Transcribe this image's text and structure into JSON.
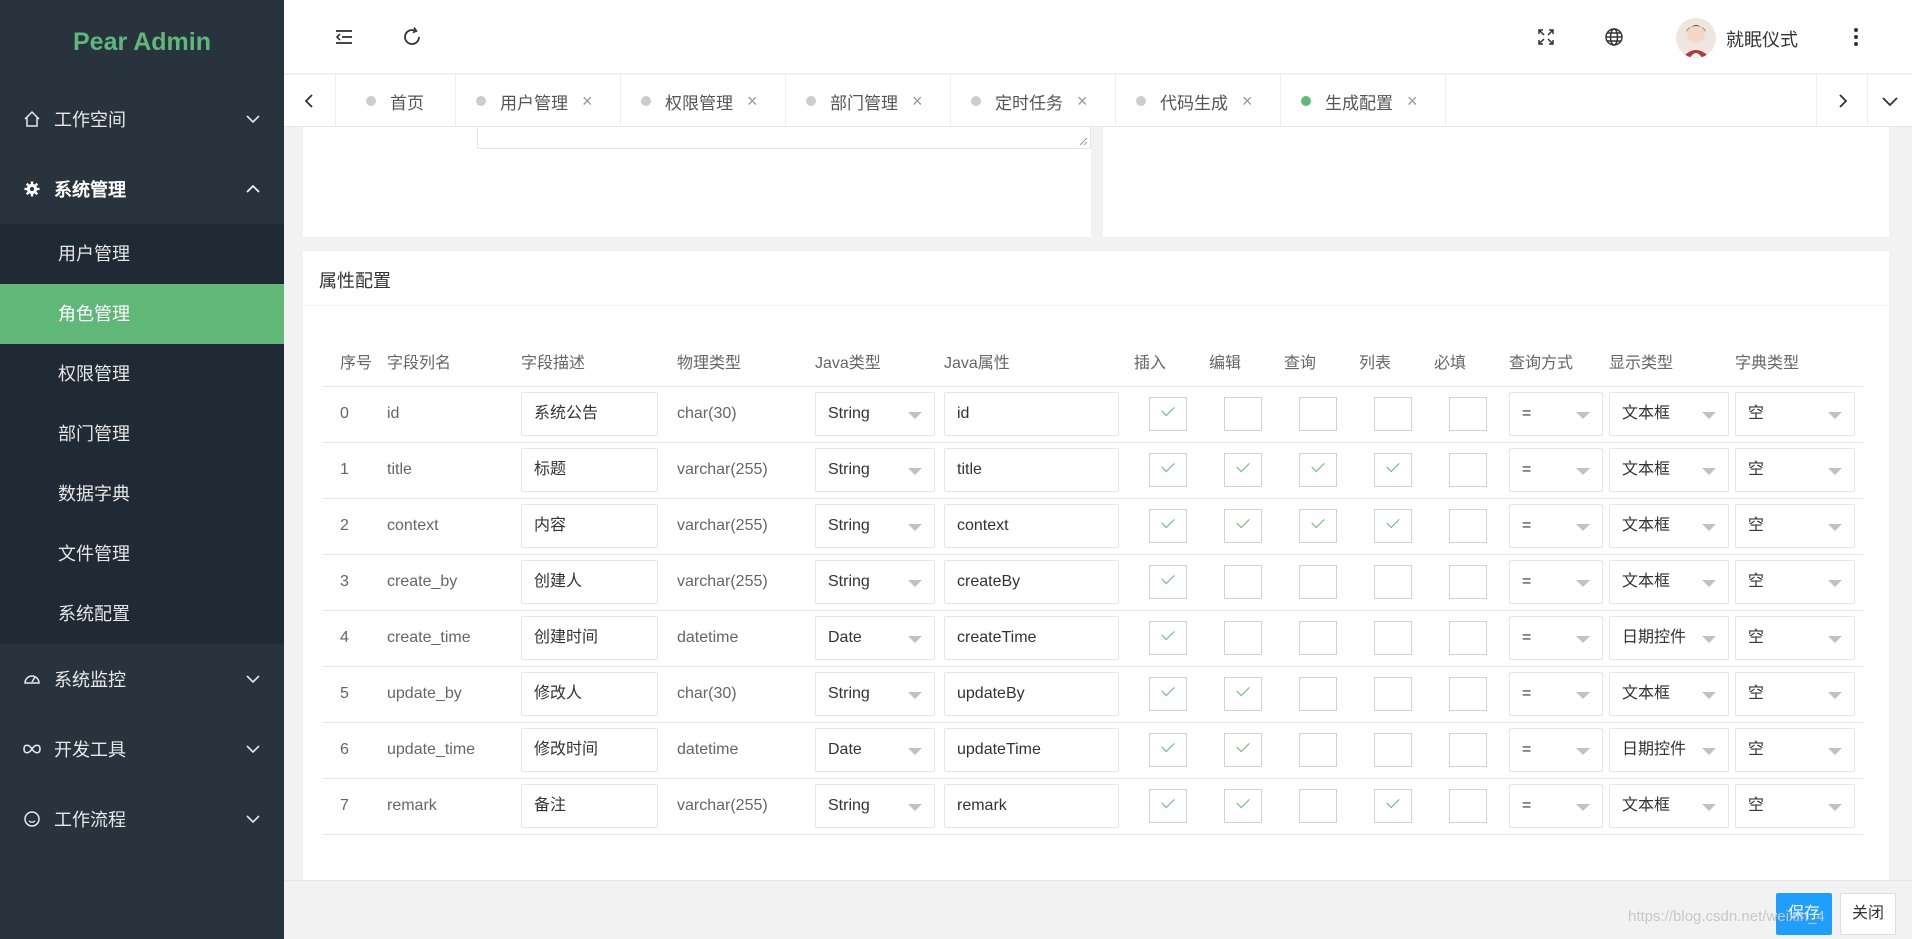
{
  "app": {
    "title": "Pear Admin"
  },
  "sidebar": {
    "groups": [
      {
        "label": "工作空间",
        "icon": "home-icon",
        "expanded": false
      },
      {
        "label": "系统管理",
        "icon": "gear-icon",
        "expanded": true
      },
      {
        "label": "系统监控",
        "icon": "dashboard-icon",
        "expanded": false
      },
      {
        "label": "开发工具",
        "icon": "infinity-icon",
        "expanded": false
      },
      {
        "label": "工作流程",
        "icon": "smile-icon",
        "expanded": false
      }
    ],
    "sub_items": [
      {
        "label": "用户管理",
        "active": false
      },
      {
        "label": "角色管理",
        "active": true
      },
      {
        "label": "权限管理",
        "active": false
      },
      {
        "label": "部门管理",
        "active": false
      },
      {
        "label": "数据字典",
        "active": false
      },
      {
        "label": "文件管理",
        "active": false
      },
      {
        "label": "系统配置",
        "active": false
      }
    ]
  },
  "header": {
    "username": "就眠仪式",
    "icons": [
      "menu-fold-icon",
      "refresh-icon",
      "fullscreen-icon",
      "globe-icon",
      "more-vertical-icon"
    ]
  },
  "tabs": [
    {
      "label": "首页",
      "closable": false,
      "active": false
    },
    {
      "label": "用户管理",
      "closable": true,
      "active": false
    },
    {
      "label": "权限管理",
      "closable": true,
      "active": false
    },
    {
      "label": "部门管理",
      "closable": true,
      "active": false
    },
    {
      "label": "定时任务",
      "closable": true,
      "active": false
    },
    {
      "label": "代码生成",
      "closable": true,
      "active": false
    },
    {
      "label": "生成配置",
      "closable": true,
      "active": true
    }
  ],
  "attr_config": {
    "title": "属性配置",
    "headers": {
      "idx": "序号",
      "name": "字段列名",
      "desc": "字段描述",
      "phys": "物理类型",
      "jtype": "Java类型",
      "jattr": "Java属性",
      "insert": "插入",
      "edit": "编辑",
      "query": "查询",
      "list": "列表",
      "required": "必填",
      "query_method": "查询方式",
      "display": "显示类型",
      "dict": "字典类型"
    },
    "rows": [
      {
        "idx": "0",
        "name": "id",
        "desc": "系统公告",
        "phys": "char(30)",
        "jtype": "String",
        "jattr": "id",
        "insert": true,
        "edit": false,
        "query": false,
        "list": false,
        "required": false,
        "query_method": "=",
        "display": "文本框",
        "dict": "空"
      },
      {
        "idx": "1",
        "name": "title",
        "desc": "标题",
        "phys": "varchar(255)",
        "jtype": "String",
        "jattr": "title",
        "insert": true,
        "edit": true,
        "query": true,
        "list": true,
        "required": false,
        "query_method": "=",
        "display": "文本框",
        "dict": "空"
      },
      {
        "idx": "2",
        "name": "context",
        "desc": "内容",
        "phys": "varchar(255)",
        "jtype": "String",
        "jattr": "context",
        "insert": true,
        "edit": true,
        "query": true,
        "list": true,
        "required": false,
        "query_method": "=",
        "display": "文本框",
        "dict": "空"
      },
      {
        "idx": "3",
        "name": "create_by",
        "desc": "创建人",
        "phys": "varchar(255)",
        "jtype": "String",
        "jattr": "createBy",
        "insert": true,
        "edit": false,
        "query": false,
        "list": false,
        "required": false,
        "query_method": "=",
        "display": "文本框",
        "dict": "空"
      },
      {
        "idx": "4",
        "name": "create_time",
        "desc": "创建时间",
        "phys": "datetime",
        "jtype": "Date",
        "jattr": "createTime",
        "insert": true,
        "edit": false,
        "query": false,
        "list": false,
        "required": false,
        "query_method": "=",
        "display": "日期控件",
        "dict": "空"
      },
      {
        "idx": "5",
        "name": "update_by",
        "desc": "修改人",
        "phys": "char(30)",
        "jtype": "String",
        "jattr": "updateBy",
        "insert": true,
        "edit": true,
        "query": false,
        "list": false,
        "required": false,
        "query_method": "=",
        "display": "文本框",
        "dict": "空"
      },
      {
        "idx": "6",
        "name": "update_time",
        "desc": "修改时间",
        "phys": "datetime",
        "jtype": "Date",
        "jattr": "updateTime",
        "insert": true,
        "edit": true,
        "query": false,
        "list": false,
        "required": false,
        "query_method": "=",
        "display": "日期控件",
        "dict": "空"
      },
      {
        "idx": "7",
        "name": "remark",
        "desc": "备注",
        "phys": "varchar(255)",
        "jtype": "String",
        "jattr": "remark",
        "insert": true,
        "edit": true,
        "query": false,
        "list": true,
        "required": false,
        "query_method": "=",
        "display": "文本框",
        "dict": "空"
      }
    ]
  },
  "footer": {
    "save_label": "保存",
    "close_label": "关闭"
  },
  "watermark": "https://blog.csdn.net/weixin_4",
  "colors": {
    "sidebar_bg": "#28333e",
    "accent_green": "#5fb878",
    "primary_blue": "#1e9fff"
  }
}
